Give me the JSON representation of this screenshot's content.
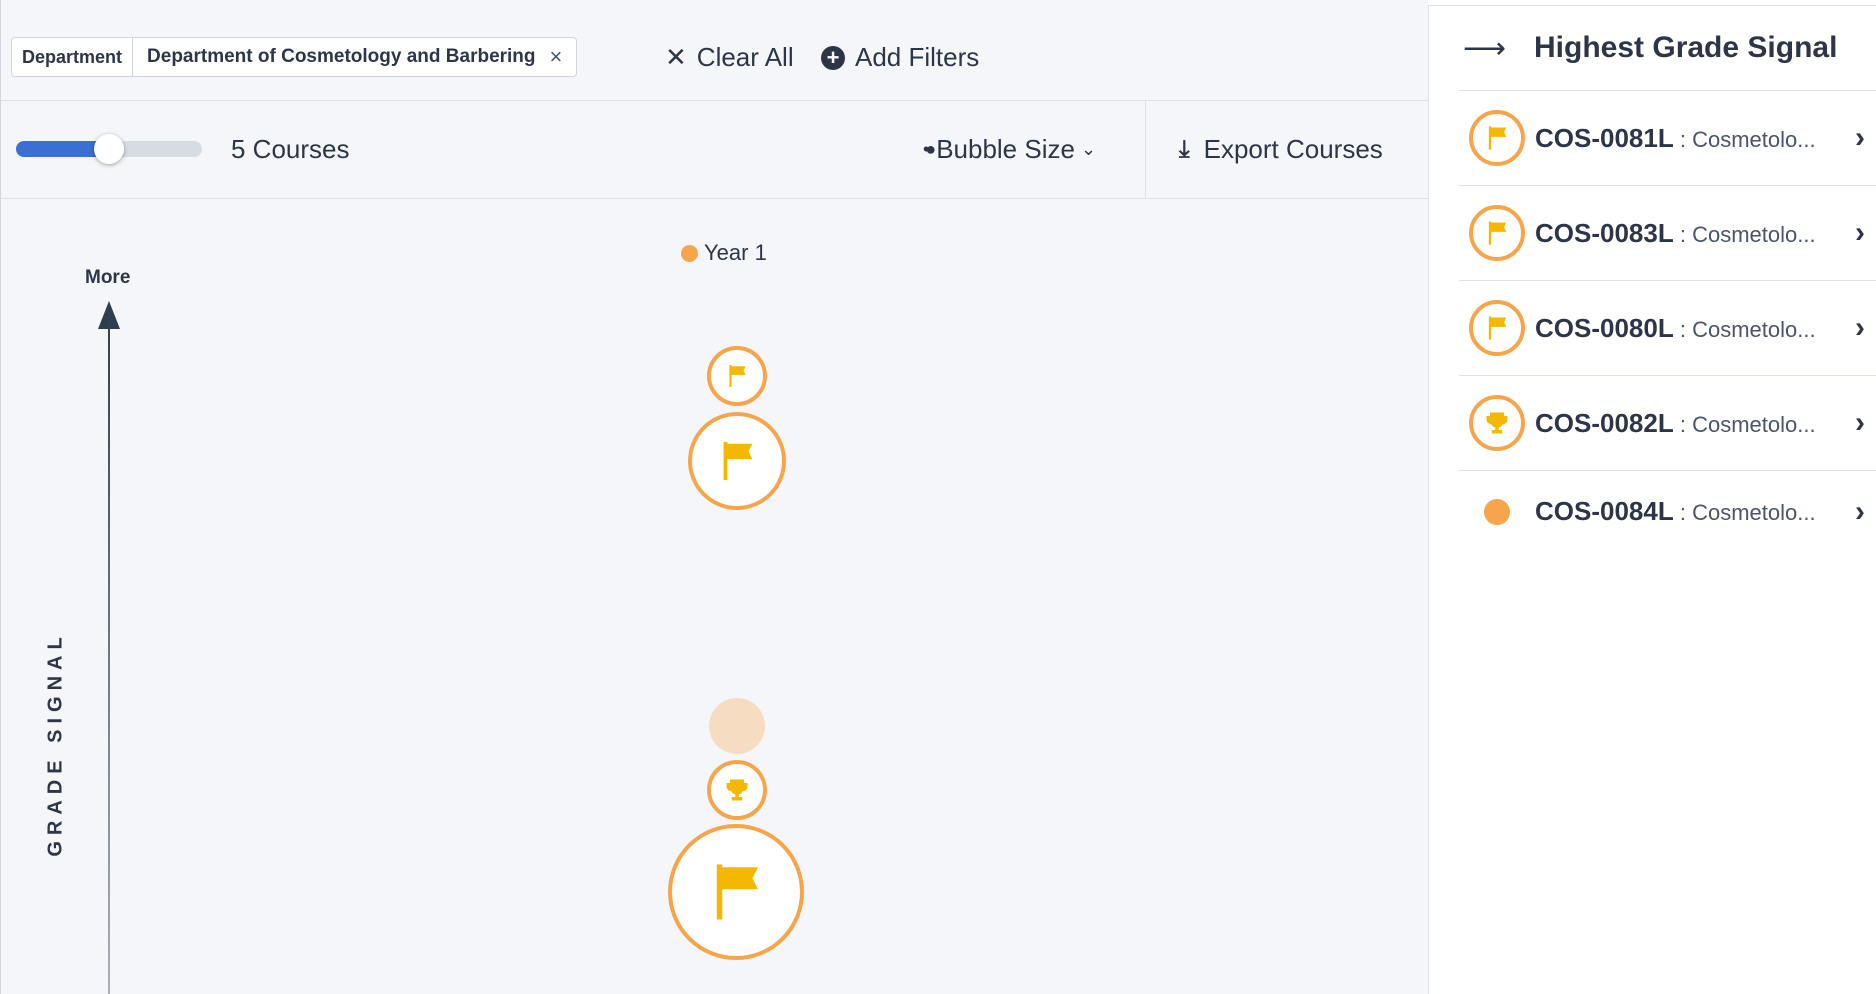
{
  "filters": {
    "chip_key": "Department",
    "chip_value": "Department of Cosmetology and Barbering",
    "chip_remove": "×",
    "clear_all": "Clear All",
    "add_filters": "Add Filters"
  },
  "toolbar": {
    "slider_value_fraction": 0.5,
    "course_count": "5 Courses",
    "bubble_size": "Bubble Size",
    "export": "Export Courses"
  },
  "chart": {
    "legend": "Year 1",
    "axis_top_label": "More",
    "axis_title": "GRADE SIGNAL",
    "colors": {
      "accent": "#f6a54a",
      "icon": "#f5b800",
      "faded": "#f6dcc1",
      "axis": "#2d3e50"
    }
  },
  "panel": {
    "title": "Highest Grade Signal",
    "courses": [
      {
        "code": "COS-0081L",
        "name": " : Cosmetolo...",
        "icon": "flag-icon"
      },
      {
        "code": "COS-0083L",
        "name": " : Cosmetolo...",
        "icon": "flag-icon"
      },
      {
        "code": "COS-0080L",
        "name": " : Cosmetolo...",
        "icon": "flag-icon"
      },
      {
        "code": "COS-0082L",
        "name": " : Cosmetolo...",
        "icon": "trophy-icon"
      },
      {
        "code": "COS-0084L",
        "name": " : Cosmetolo...",
        "icon": "dot-icon"
      }
    ]
  }
}
